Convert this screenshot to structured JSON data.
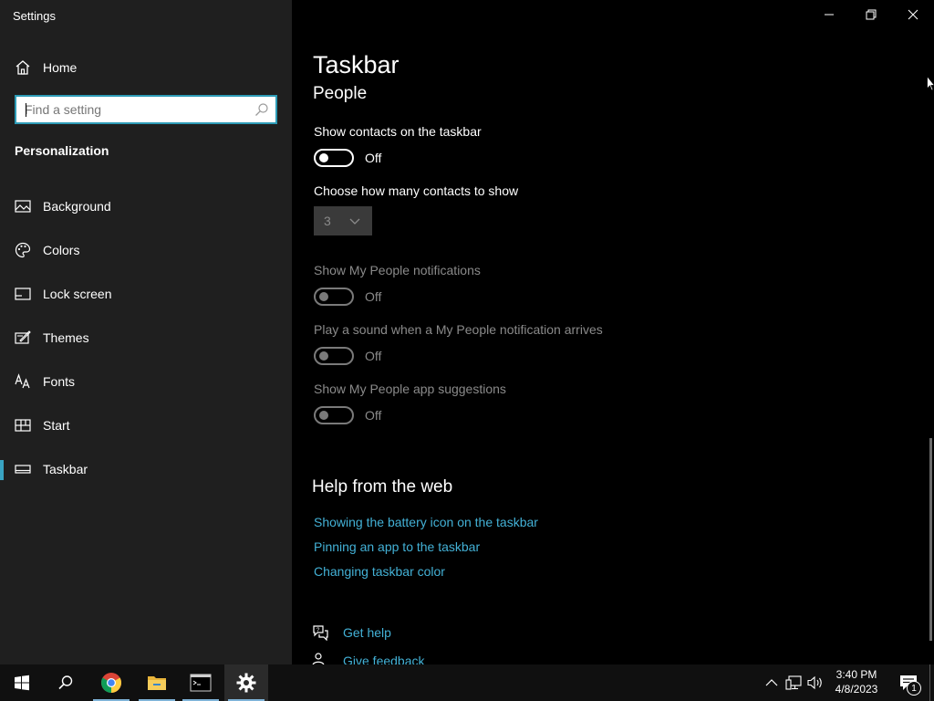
{
  "window": {
    "title": "Settings"
  },
  "sidebar": {
    "home_label": "Home",
    "search_placeholder": "Find a setting",
    "section_title": "Personalization",
    "items": [
      {
        "label": "Background",
        "icon": "picture-icon"
      },
      {
        "label": "Colors",
        "icon": "palette-icon"
      },
      {
        "label": "Lock screen",
        "icon": "lock-screen-icon"
      },
      {
        "label": "Themes",
        "icon": "themes-icon"
      },
      {
        "label": "Fonts",
        "icon": "fonts-icon"
      },
      {
        "label": "Start",
        "icon": "start-icon"
      },
      {
        "label": "Taskbar",
        "icon": "taskbar-icon",
        "selected": true
      }
    ]
  },
  "main": {
    "page_title": "Taskbar",
    "group_title": "People",
    "settings": [
      {
        "label": "Show contacts on the taskbar",
        "state": "Off",
        "enabled": true
      },
      {
        "label": "Choose how many contacts to show",
        "dropdown_value": "3",
        "enabled": false
      },
      {
        "label": "Show My People notifications",
        "state": "Off",
        "enabled": false
      },
      {
        "label": "Play a sound when a My People notification arrives",
        "state": "Off",
        "enabled": false
      },
      {
        "label": "Show My People app suggestions",
        "state": "Off",
        "enabled": false
      }
    ],
    "help_title": "Help from the web",
    "help_links": [
      "Showing the battery icon on the taskbar",
      "Pinning an app to the taskbar",
      "Changing taskbar color"
    ],
    "get_help": "Get help",
    "give_feedback": "Give feedback"
  },
  "taskbar": {
    "apps": [
      "start-icon",
      "search-icon",
      "chrome-icon",
      "file-explorer-icon",
      "terminal-icon",
      "settings-gear-icon"
    ],
    "time": "3:40 PM",
    "date": "4/8/2023",
    "notification_count": "1"
  },
  "colors": {
    "accent": "#39a3c2",
    "link": "#43b1d6",
    "sidebar_bg": "#1f1f1f",
    "main_bg": "#000000"
  }
}
